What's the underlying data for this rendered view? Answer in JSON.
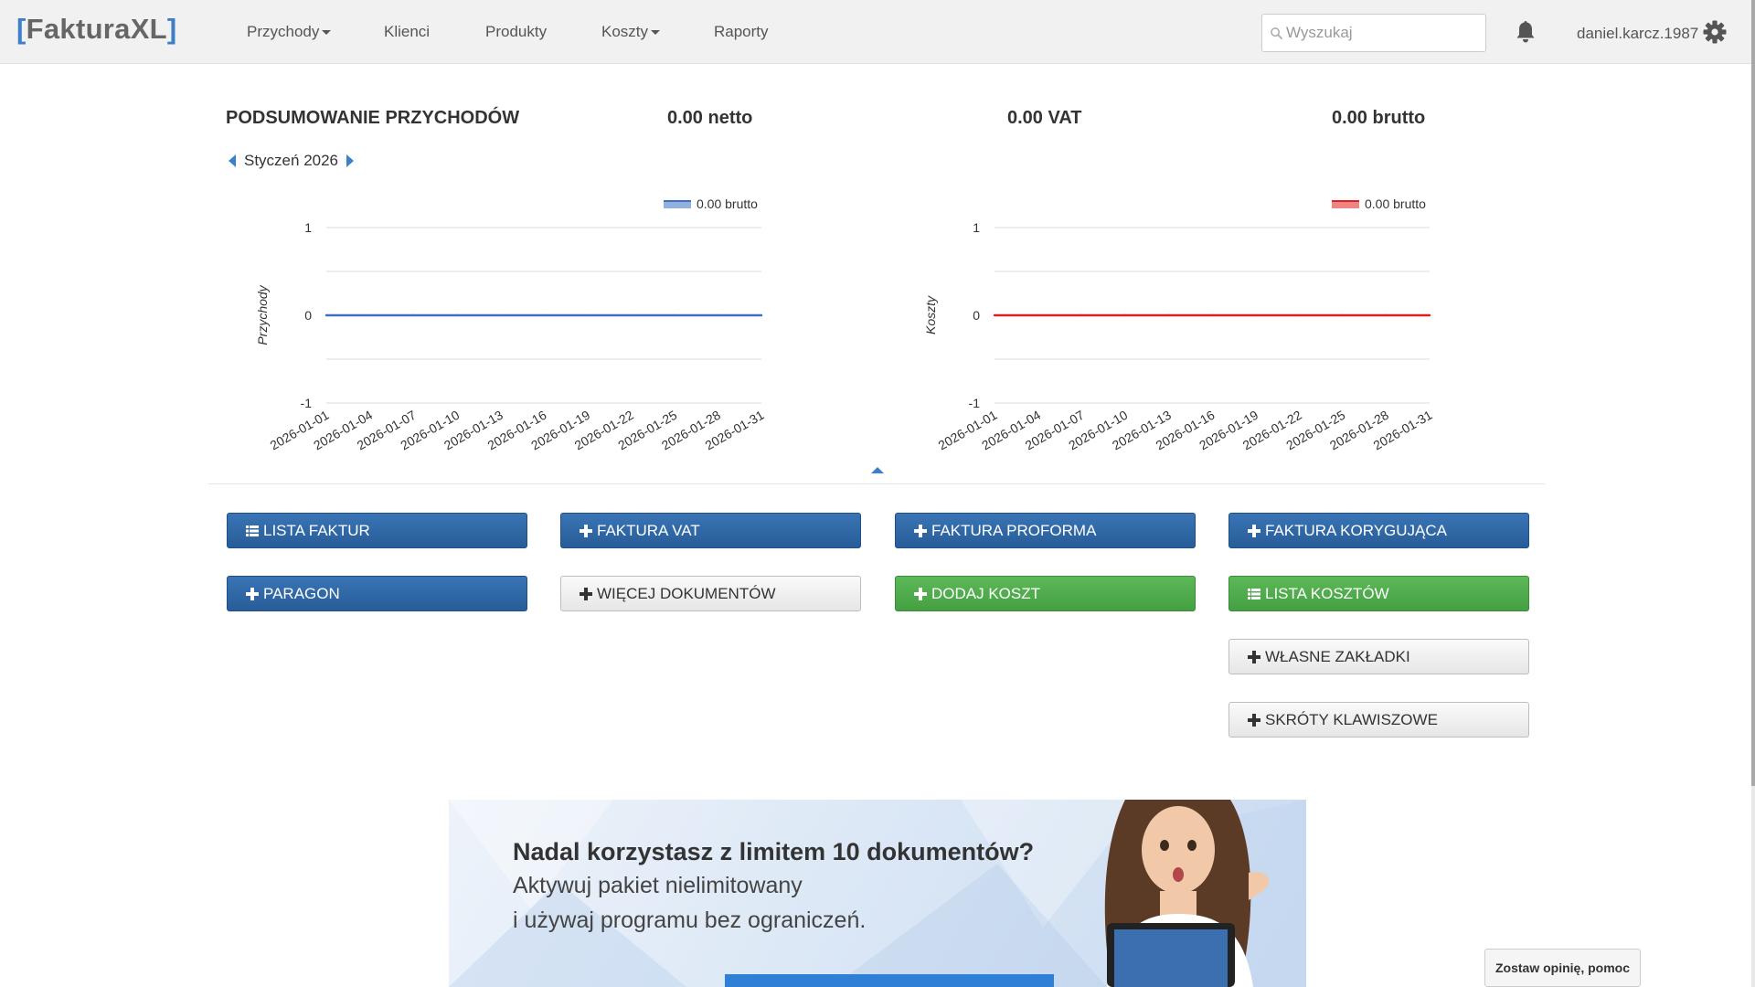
{
  "navbar": {
    "brand_open": "[",
    "brand_name": "FakturaXL",
    "brand_close": "]",
    "items": [
      {
        "label": "Przychody",
        "dropdown": true
      },
      {
        "label": "Klienci",
        "dropdown": false
      },
      {
        "label": "Produkty",
        "dropdown": false
      },
      {
        "label": "Koszty",
        "dropdown": true
      },
      {
        "label": "Raporty",
        "dropdown": false
      }
    ],
    "search_placeholder": "Wyszukaj",
    "search_value": "",
    "username": "daniel.karcz.1987"
  },
  "summary": {
    "title": "PODSUMOWANIE PRZYCHODÓW",
    "netto": "0.00 netto",
    "vat": "0.00 VAT",
    "brutto": "0.00 brutto",
    "month": "Styczeń 2026"
  },
  "chart_data": [
    {
      "type": "line",
      "ylabel": "Przychody",
      "xlabel": "",
      "x": [
        "2026-01-01",
        "2026-01-04",
        "2026-01-07",
        "2026-01-10",
        "2026-01-13",
        "2026-01-16",
        "2026-01-19",
        "2026-01-22",
        "2026-01-25",
        "2026-01-28",
        "2026-01-31"
      ],
      "yticks": [
        "1",
        "0",
        "-1"
      ],
      "ylim": [
        -1,
        1
      ],
      "series": [
        {
          "name": "0.00 brutto",
          "color": "#3d6fc4",
          "values": [
            0,
            0,
            0,
            0,
            0,
            0,
            0,
            0,
            0,
            0,
            0
          ]
        }
      ],
      "legend": "top-right",
      "grid": true
    },
    {
      "type": "line",
      "ylabel": "Koszty",
      "xlabel": "",
      "x": [
        "2026-01-01",
        "2026-01-04",
        "2026-01-07",
        "2026-01-10",
        "2026-01-13",
        "2026-01-16",
        "2026-01-19",
        "2026-01-22",
        "2026-01-25",
        "2026-01-28",
        "2026-01-31"
      ],
      "yticks": [
        "1",
        "0",
        "-1"
      ],
      "ylim": [
        -1,
        1
      ],
      "series": [
        {
          "name": "0.00 brutto",
          "color": "#e02020",
          "values": [
            0,
            0,
            0,
            0,
            0,
            0,
            0,
            0,
            0,
            0,
            0
          ]
        }
      ],
      "legend": "top-right",
      "grid": true
    }
  ],
  "buttons": {
    "lista_faktur": "LISTA FAKTUR",
    "faktura_vat": "FAKTURA VAT",
    "faktura_proforma": "FAKTURA PROFORMA",
    "faktura_korygujaca": "FAKTURA KORYGUJĄCA",
    "paragon": "PARAGON",
    "wiecej_dokumentow": "WIĘCEJ DOKUMENTÓW",
    "dodaj_koszt": "DODAJ KOSZT",
    "lista_kosztow": "LISTA KOSZTÓW",
    "wlasne_zakladki": "WŁASNE ZAKŁADKI",
    "skroty_klawiszowe": "SKRÓTY KLAWISZOWE"
  },
  "banner": {
    "headline": "Nadal korzystasz z limitem 10 dokumentów?",
    "line2": "Aktywuj pakiet nielimitowany",
    "line3": "i używaj programu bez ograniczeń."
  },
  "feedback_label": "Zostaw opinię, pomoc",
  "colors": {
    "primary_blue": "#2b64a3",
    "green": "#4eab4b",
    "accent": "#3d80c8"
  }
}
